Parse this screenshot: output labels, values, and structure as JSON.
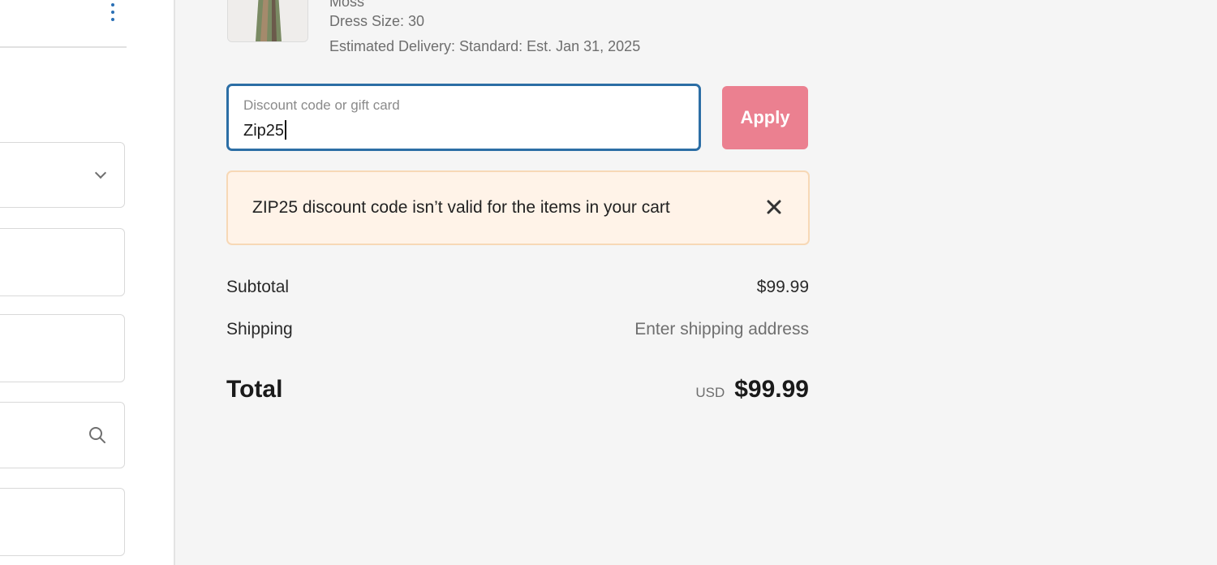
{
  "left_panel": {
    "icons": {
      "menu": "kebab-vertical-icon",
      "dropdown": "chevron-down-icon",
      "search": "search-icon"
    }
  },
  "order_item": {
    "variant_text": "Moss",
    "dress_size": "Dress Size: 30",
    "delivery": "Estimated Delivery: Standard: Est. Jan 31, 2025"
  },
  "discount": {
    "placeholder": "Discount code or gift card",
    "value": "Zip25",
    "apply_label": "Apply"
  },
  "alert": {
    "message": "ZIP25 discount code isn’t valid for the items in your cart",
    "close_icon": "close-icon"
  },
  "summary": {
    "subtotal_label": "Subtotal",
    "subtotal_value": "$99.99",
    "shipping_label": "Shipping",
    "shipping_value": "Enter shipping address",
    "total_label": "Total",
    "currency": "USD",
    "total_value": "$99.99"
  },
  "colors": {
    "accent_border": "#2c6ea5",
    "apply_button": "#eb8090",
    "alert_bg": "#fff3e8",
    "alert_border": "#f7d8b6"
  }
}
